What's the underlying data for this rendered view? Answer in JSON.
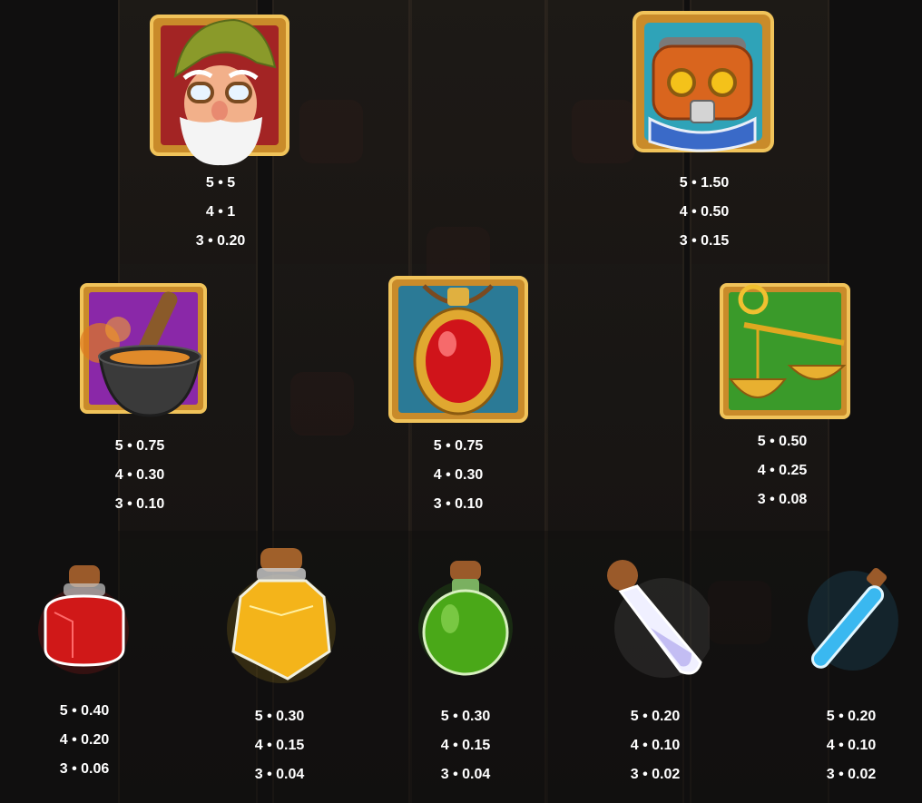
{
  "symbols": [
    {
      "id": "gnome",
      "icon": "gnome-inventor-icon",
      "pays": [
        "5 • 5",
        "4 • 1",
        "3 • 0.20"
      ]
    },
    {
      "id": "robot",
      "icon": "robot-head-icon",
      "pays": [
        "5 • 1.50",
        "4 • 0.50",
        "3 • 0.15"
      ]
    },
    {
      "id": "mortar",
      "icon": "mortar-pestle-icon",
      "pays": [
        "5 • 0.75",
        "4 • 0.30",
        "3 • 0.10"
      ]
    },
    {
      "id": "amulet",
      "icon": "red-amulet-icon",
      "pays": [
        "5 • 0.75",
        "4 • 0.30",
        "3 • 0.10"
      ]
    },
    {
      "id": "scales",
      "icon": "golden-scales-icon",
      "pays": [
        "5 • 0.50",
        "4 • 0.25",
        "3 • 0.08"
      ]
    },
    {
      "id": "red_potion",
      "icon": "red-potion-icon",
      "pays": [
        "5 • 0.40",
        "4 • 0.20",
        "3 • 0.06"
      ]
    },
    {
      "id": "yellow_potion",
      "icon": "yellow-potion-icon",
      "pays": [
        "5 • 0.30",
        "4 • 0.15",
        "3 • 0.04"
      ]
    },
    {
      "id": "green_potion",
      "icon": "green-potion-icon",
      "pays": [
        "5 • 0.30",
        "4 • 0.15",
        "3 • 0.04"
      ]
    },
    {
      "id": "white_potion",
      "icon": "white-potion-icon",
      "pays": [
        "5 • 0.20",
        "4 • 0.10",
        "3 • 0.02"
      ]
    },
    {
      "id": "blue_vial",
      "icon": "blue-vial-icon",
      "pays": [
        "5 • 0.20",
        "4 • 0.10",
        "3 • 0.02"
      ]
    }
  ],
  "colors": {
    "text": "#ffffff",
    "frame_gold": "#d9a437",
    "background": "#141313"
  }
}
